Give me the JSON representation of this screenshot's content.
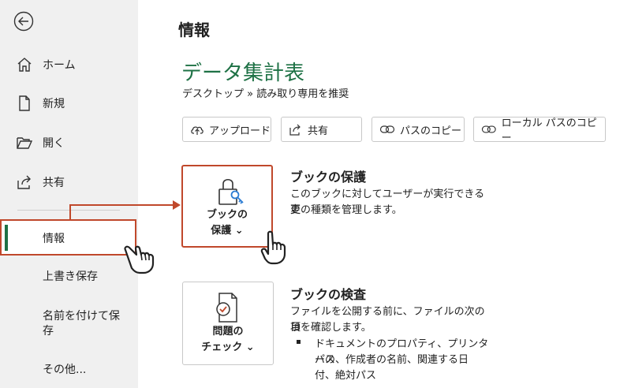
{
  "sidebar": {
    "items": [
      {
        "label": "ホーム",
        "icon": "home-icon"
      },
      {
        "label": "新規",
        "icon": "new-document-icon"
      },
      {
        "label": "開く",
        "icon": "folder-open-icon"
      },
      {
        "label": "共有",
        "icon": "share-icon"
      }
    ],
    "active_label": "情報",
    "lower_items": [
      "上書き保存",
      "名前を付けて保",
      "存",
      "その他..."
    ]
  },
  "main": {
    "heading": "情報",
    "doc_title": "データ集計表",
    "breadcrumb": "デスクトップ » 読み取り専用を推奨",
    "buttons": [
      {
        "label": "アップロード",
        "icon": "upload-icon"
      },
      {
        "label": "共有",
        "icon": "share-icon"
      },
      {
        "label": "パスのコピー",
        "icon": "link-icon"
      },
      {
        "label": "ローカル パスのコピー",
        "icon": "link-icon"
      }
    ],
    "protect": {
      "card_line1": "ブックの",
      "card_line2": "保護 ⌄",
      "title": "ブックの保護",
      "desc_line1": "このブックに対してユーザーが実行できる変",
      "desc_line2": "更の種類を管理します。"
    },
    "inspect": {
      "card_line1": "問題の",
      "card_line2": "チェック ⌄",
      "title": "ブックの検査",
      "desc_line1": "ファイルを公開する前に、ファイルの次の項",
      "desc_line2": "目を確認します。",
      "bullet_line1": "ドキュメントのプロパティ、プリンターの",
      "bullet_line2": "パス、作成者の名前、関連する日",
      "bullet_line3": "付、絶対パス"
    }
  },
  "colors": {
    "accent_green": "#1e7145",
    "highlight_red": "#c0482b",
    "sidebar_bg": "#f0f0f0"
  }
}
